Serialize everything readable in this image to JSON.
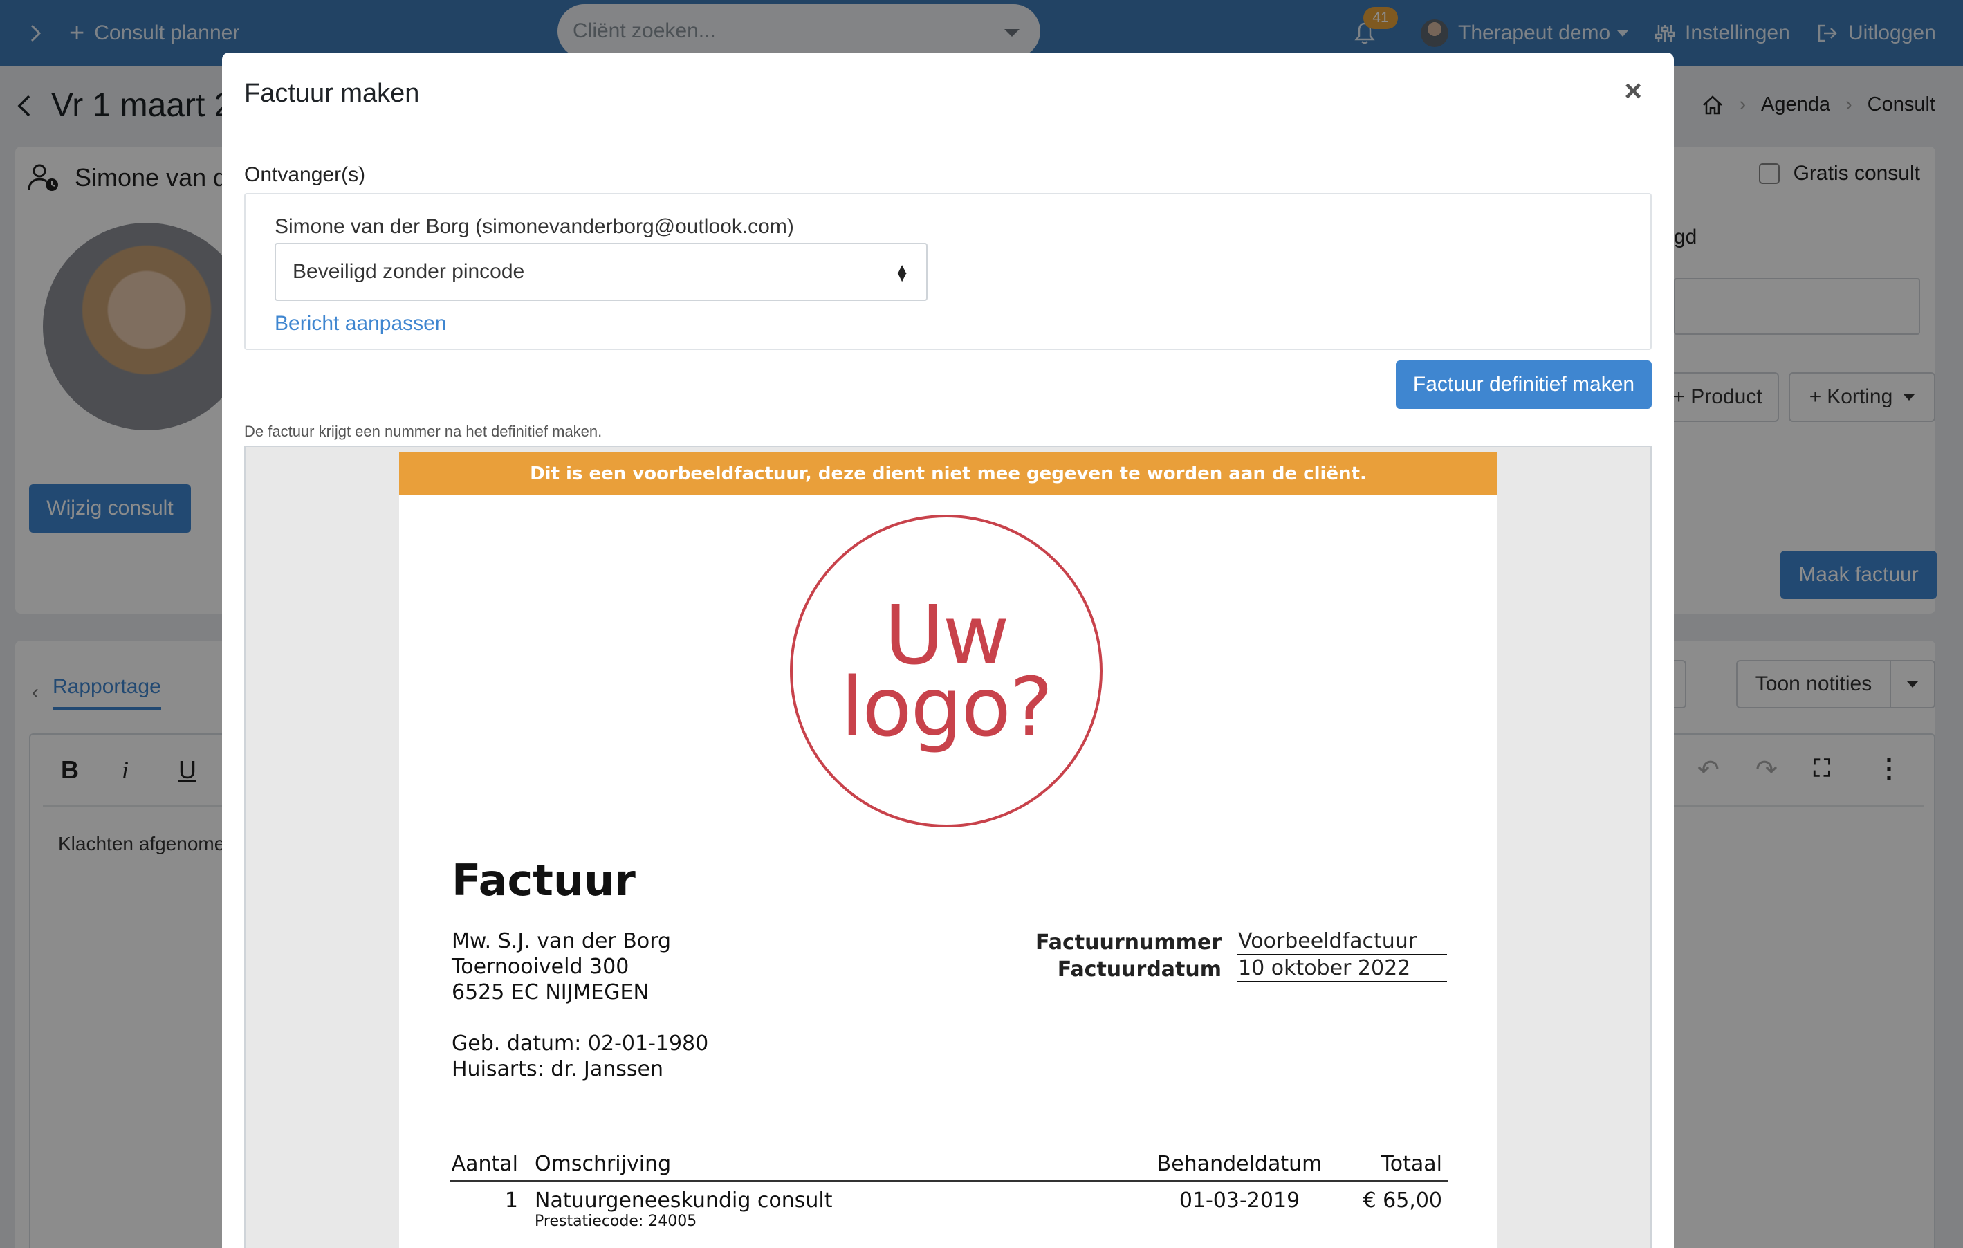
{
  "topbar": {
    "consult_planner": "Consult planner",
    "search_placeholder": "Cliënt zoeken...",
    "notification_count": "41",
    "user": "Therapeut demo",
    "settings": "Instellingen",
    "logout": "Uitloggen"
  },
  "page": {
    "title": "Vr 1 maart 2",
    "breadcrumb": [
      "Agenda",
      "Consult"
    ],
    "client_name": "Simone van d",
    "free_consult": "Gratis consult",
    "gd_label": "gd",
    "edit_consult": "Wijzig consult",
    "product_btn": "+ Product",
    "discount_btn": "Korting",
    "make_invoice": "Maak factuur",
    "tab_report": "Rapportage",
    "show_notes": "Toon notities",
    "editor_text": "Klachten afgenome"
  },
  "modal": {
    "title": "Factuur maken",
    "close": "×",
    "recipients_label": "Ontvanger(s)",
    "recipient": "Simone van der Borg (simonevanderborg@outlook.com)",
    "security_option": "Beveiligd zonder pincode",
    "edit_message": "Bericht aanpassen",
    "finalize": "Factuur definitief maken",
    "note": "De factuur krijgt een nummer na het definitief maken."
  },
  "invoice": {
    "warning": "Dit is een voorbeeldfactuur, deze dient niet mee gegeven te worden aan de cliënt.",
    "logo_line1": "Uw",
    "logo_line2": "logo?",
    "heading": "Factuur",
    "address": [
      "Mw. S.J. van der Borg",
      "Toernooiveld 300",
      "6525 EC  NIJMEGEN"
    ],
    "birth": "Geb. datum: 02-01-1980",
    "gp": "Huisarts: dr. Janssen",
    "number_label": "Factuurnummer",
    "number_value": "Voorbeeldfactuur",
    "date_label": "Factuurdatum",
    "date_value": "10 oktober 2022",
    "columns": [
      "Aantal",
      "Omschrijving",
      "Behandeldatum",
      "Totaal"
    ],
    "rows": [
      {
        "qty": "1",
        "desc": "Natuurgeneeskundig consult",
        "code": "Prestatiecode: 24005",
        "date": "01-03-2019",
        "total": "€ 65,00"
      }
    ]
  },
  "colors": {
    "primary": "#3f86d0",
    "navbar": "#3f7ab6",
    "warning": "#e99f3a",
    "logo_red": "#c8424b"
  }
}
